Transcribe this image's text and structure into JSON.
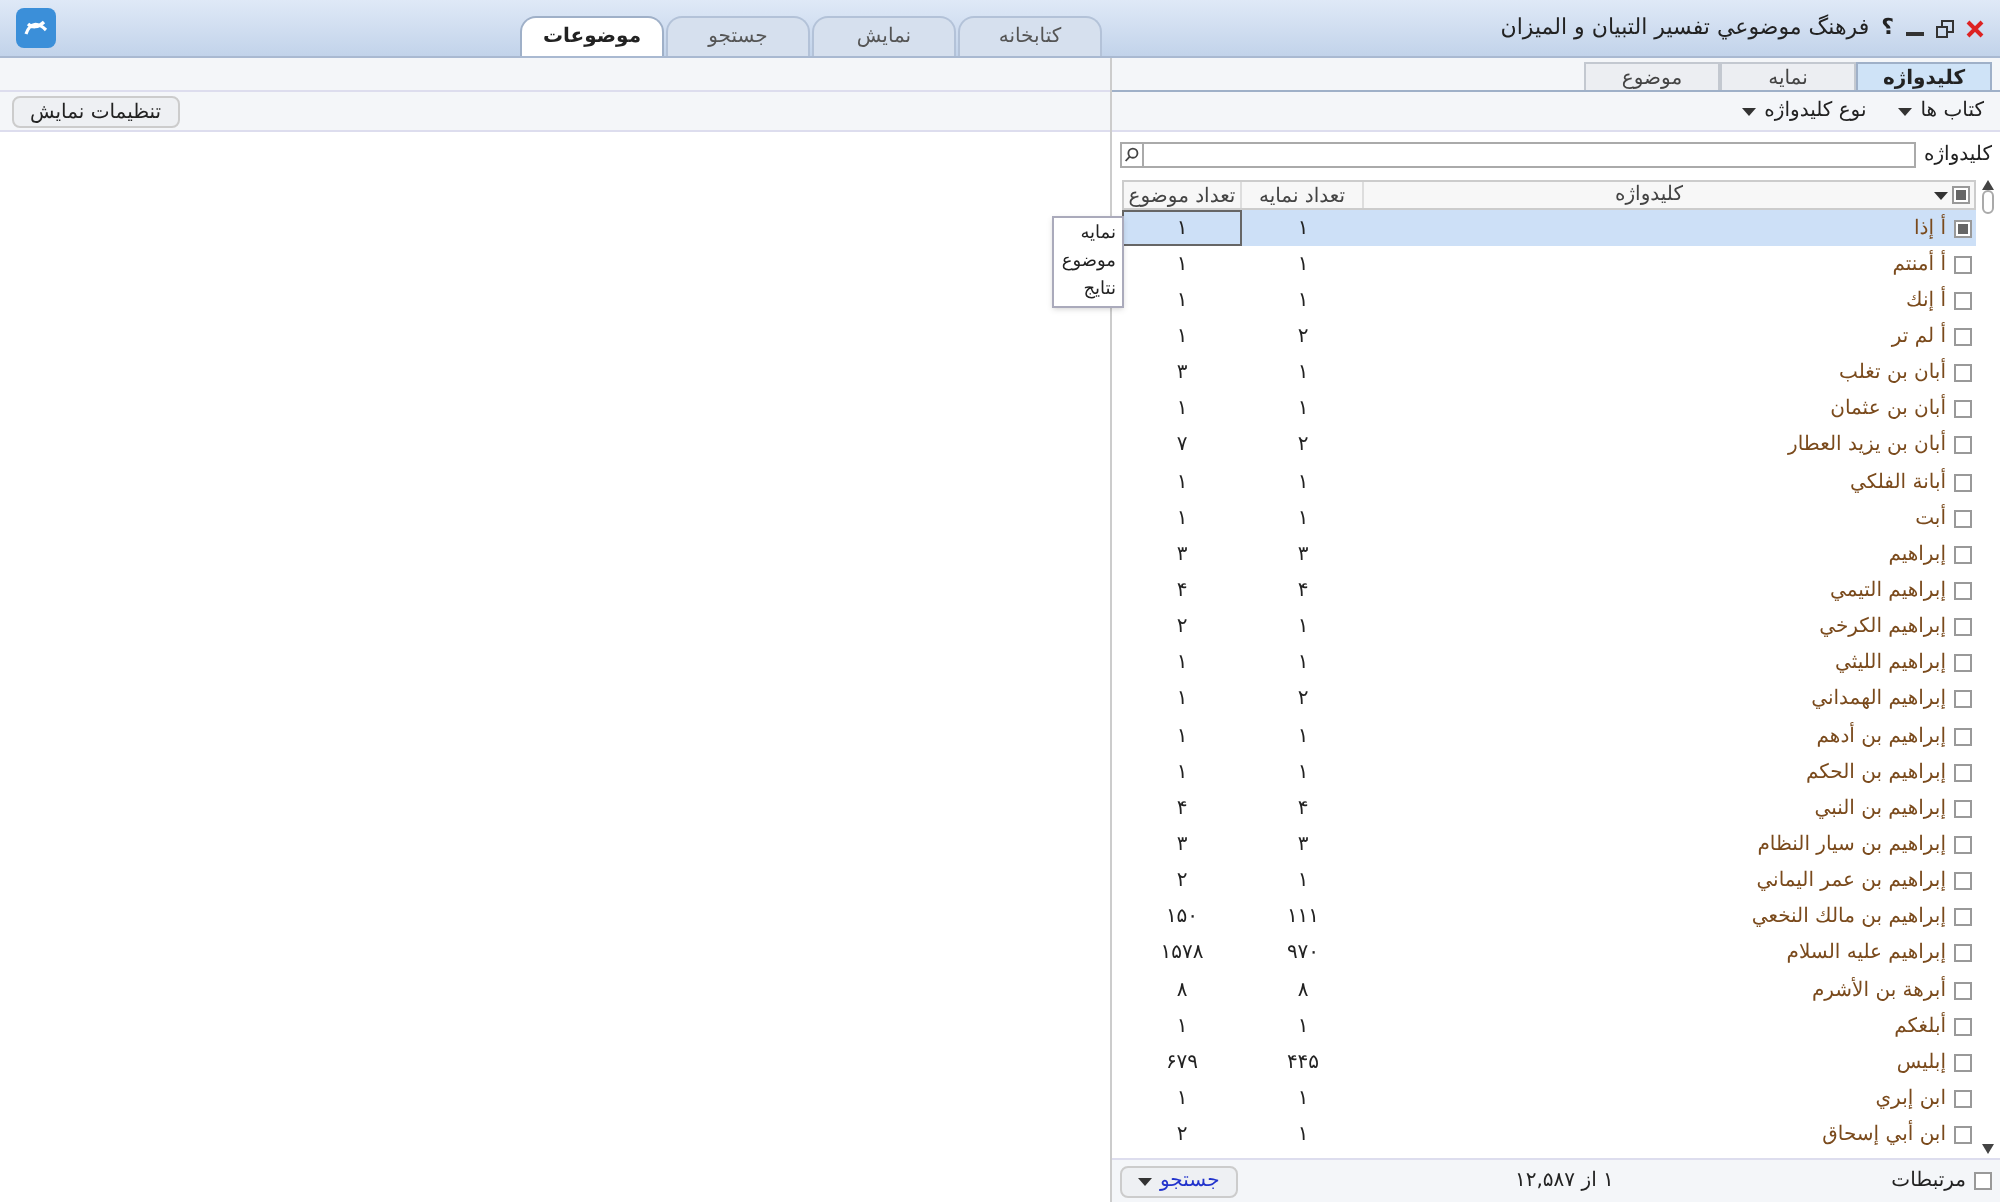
{
  "window": {
    "title": "فرهنگ موضوعي تفسير التبيان و الميزان",
    "help": "؟"
  },
  "main_tabs": [
    {
      "label": "کتابخانه",
      "selected": false
    },
    {
      "label": "نمایش",
      "selected": false
    },
    {
      "label": "جستجو",
      "selected": false
    },
    {
      "label": "موضوعات",
      "selected": true
    }
  ],
  "sub_tabs": [
    {
      "label": "کلیدواژه",
      "selected": true
    },
    {
      "label": "نمایه",
      "selected": false
    },
    {
      "label": "موضوع",
      "selected": false
    }
  ],
  "toolbar": {
    "books": "کتاب ها",
    "keyword_type": "نوع کلیدواژه"
  },
  "display_settings": "تنظیمات نمایش",
  "search": {
    "label": "کلیدواژه"
  },
  "table": {
    "select_all_checked": true,
    "columns": [
      "کلیدواژه",
      "تعداد نمایه",
      "تعداد موضوع"
    ],
    "rows": [
      {
        "keyword": "أ إذا",
        "index_count": "۱",
        "topic_count": "۱",
        "checked": true,
        "selected": true
      },
      {
        "keyword": "أ أمنتم",
        "index_count": "۱",
        "topic_count": "۱",
        "checked": false,
        "selected": false
      },
      {
        "keyword": "أ إنك",
        "index_count": "۱",
        "topic_count": "۱",
        "checked": false,
        "selected": false
      },
      {
        "keyword": "أ لم تر",
        "index_count": "۲",
        "topic_count": "۱",
        "checked": false,
        "selected": false
      },
      {
        "keyword": "أبان بن تغلب",
        "index_count": "۱",
        "topic_count": "۳",
        "checked": false,
        "selected": false
      },
      {
        "keyword": "أبان بن عثمان",
        "index_count": "۱",
        "topic_count": "۱",
        "checked": false,
        "selected": false
      },
      {
        "keyword": "أبان بن يزيد العطار",
        "index_count": "۲",
        "topic_count": "۷",
        "checked": false,
        "selected": false
      },
      {
        "keyword": "أبانة الفلكي",
        "index_count": "۱",
        "topic_count": "۱",
        "checked": false,
        "selected": false
      },
      {
        "keyword": "أبت",
        "index_count": "۱",
        "topic_count": "۱",
        "checked": false,
        "selected": false
      },
      {
        "keyword": "إبراهيم",
        "index_count": "۳",
        "topic_count": "۳",
        "checked": false,
        "selected": false
      },
      {
        "keyword": "إبراهيم التيمي",
        "index_count": "۴",
        "topic_count": "۴",
        "checked": false,
        "selected": false
      },
      {
        "keyword": "إبراهيم الكرخي",
        "index_count": "۱",
        "topic_count": "۲",
        "checked": false,
        "selected": false
      },
      {
        "keyword": "إبراهيم الليثي",
        "index_count": "۱",
        "topic_count": "۱",
        "checked": false,
        "selected": false
      },
      {
        "keyword": "إبراهيم الهمداني",
        "index_count": "۲",
        "topic_count": "۱",
        "checked": false,
        "selected": false
      },
      {
        "keyword": "إبراهيم بن أدهم",
        "index_count": "۱",
        "topic_count": "۱",
        "checked": false,
        "selected": false
      },
      {
        "keyword": "إبراهيم بن الحكم",
        "index_count": "۱",
        "topic_count": "۱",
        "checked": false,
        "selected": false
      },
      {
        "keyword": "إبراهيم بن النبي",
        "index_count": "۴",
        "topic_count": "۴",
        "checked": false,
        "selected": false
      },
      {
        "keyword": "إبراهيم بن سيار النظام",
        "index_count": "۳",
        "topic_count": "۳",
        "checked": false,
        "selected": false
      },
      {
        "keyword": "إبراهيم بن عمر اليماني",
        "index_count": "۱",
        "topic_count": "۲",
        "checked": false,
        "selected": false
      },
      {
        "keyword": "إبراهيم بن مالك النخعي",
        "index_count": "۱۱۱",
        "topic_count": "۱۵۰",
        "checked": false,
        "selected": false
      },
      {
        "keyword": "إبراهيم عليه السلام",
        "index_count": "۹۷۰",
        "topic_count": "۱۵۷۸",
        "checked": false,
        "selected": false
      },
      {
        "keyword": "أبرهة بن الأشرم",
        "index_count": "۸",
        "topic_count": "۸",
        "checked": false,
        "selected": false
      },
      {
        "keyword": "أبلغكم",
        "index_count": "۱",
        "topic_count": "۱",
        "checked": false,
        "selected": false
      },
      {
        "keyword": "إبليس",
        "index_count": "۴۴۵",
        "topic_count": "۶۷۹",
        "checked": false,
        "selected": false
      },
      {
        "keyword": "ابن إبري",
        "index_count": "۱",
        "topic_count": "۱",
        "checked": false,
        "selected": false
      },
      {
        "keyword": "ابن أبي إسحاق",
        "index_count": "۱",
        "topic_count": "۲",
        "checked": false,
        "selected": false
      }
    ]
  },
  "popup_menu": [
    "نمایه",
    "موضوع",
    "نتایج"
  ],
  "footer": {
    "related": "مرتبطات",
    "related_checked": false,
    "paging": "۱ از ۱۲,۵۸۷",
    "search_button": "جستجو"
  }
}
